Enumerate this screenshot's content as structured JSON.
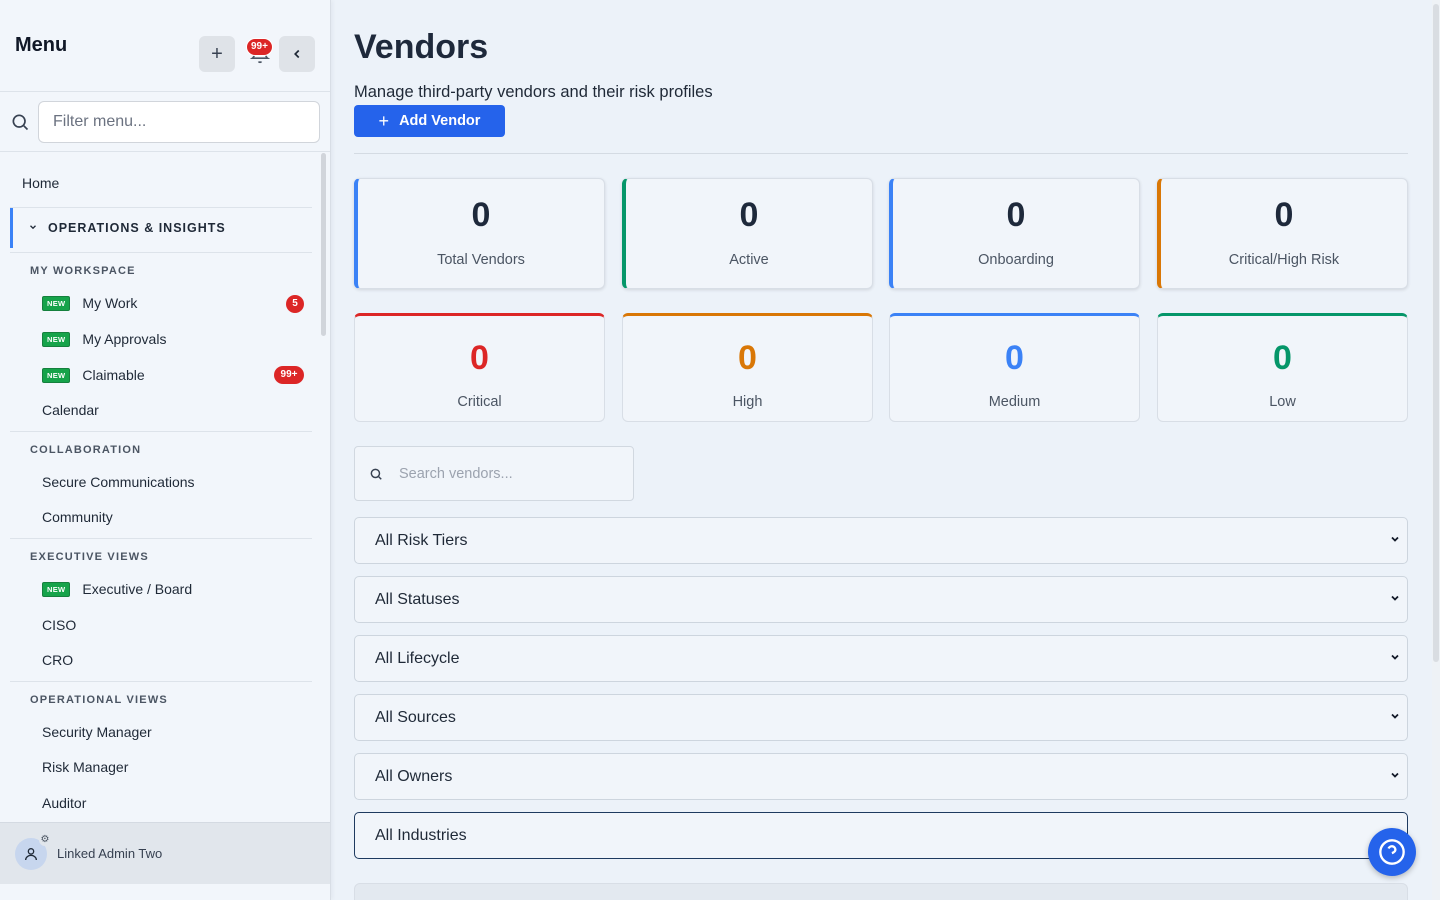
{
  "sidebar": {
    "title": "Menu",
    "notification_badge": "99+",
    "filter_placeholder": "Filter menu...",
    "home": "Home",
    "section": "OPERATIONS & INSIGHTS",
    "groups": {
      "my_workspace": "MY WORKSPACE",
      "collaboration": "COLLABORATION",
      "executive_views": "EXECUTIVE VIEWS",
      "operational_views": "OPERATIONAL VIEWS"
    },
    "new_label": "NEW",
    "items": {
      "my_work": "My Work",
      "my_work_count": "5",
      "my_approvals": "My Approvals",
      "claimable": "Claimable",
      "claimable_count": "99+",
      "calendar": "Calendar",
      "secure_comms": "Secure Communications",
      "community": "Community",
      "exec_board": "Executive / Board",
      "ciso": "CISO",
      "cro": "CRO",
      "security_manager": "Security Manager",
      "risk_manager": "Risk Manager",
      "auditor": "Auditor"
    },
    "user_name": "Linked Admin Two"
  },
  "main": {
    "title": "Vendors",
    "subtitle": "Manage third-party vendors and their risk profiles",
    "add_button": "Add Vendor",
    "stats_row1": [
      {
        "value": "0",
        "label": "Total Vendors",
        "color": "#3b82f6"
      },
      {
        "value": "0",
        "label": "Active",
        "color": "#059669"
      },
      {
        "value": "0",
        "label": "Onboarding",
        "color": "#3b82f6"
      },
      {
        "value": "0",
        "label": "Critical/High Risk",
        "color": "#d97706"
      }
    ],
    "stats_row2": [
      {
        "value": "0",
        "label": "Critical",
        "color": "#dc2626"
      },
      {
        "value": "0",
        "label": "High",
        "color": "#d97706"
      },
      {
        "value": "0",
        "label": "Medium",
        "color": "#3b82f6"
      },
      {
        "value": "0",
        "label": "Low",
        "color": "#059669"
      }
    ],
    "search_placeholder": "Search vendors...",
    "filters": {
      "risk_tiers": "All Risk Tiers",
      "statuses": "All Statuses",
      "lifecycle": "All Lifecycle",
      "sources": "All Sources",
      "owners": "All Owners",
      "industries": "All Industries"
    }
  },
  "colors": {
    "primary": "#2563eb",
    "badge_red": "#dc2626",
    "new_green": "#16a34a"
  }
}
